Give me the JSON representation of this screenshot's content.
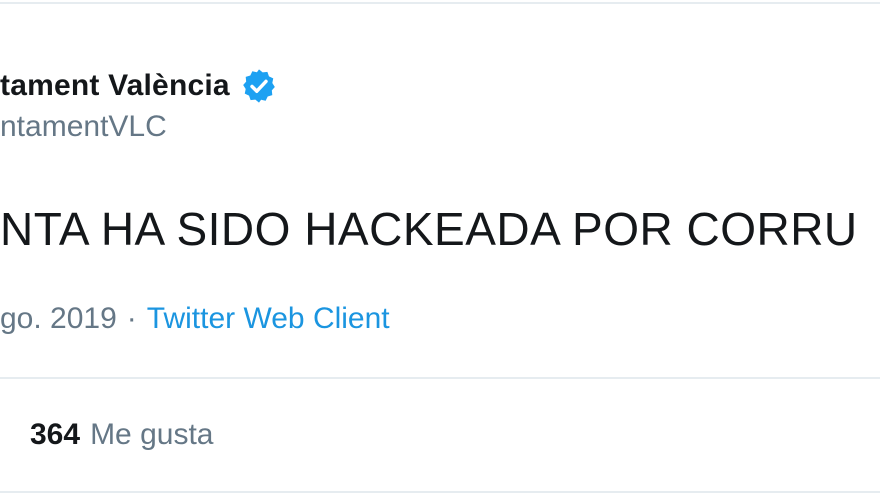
{
  "tweet": {
    "author_name": "tament València",
    "handle": "ntamentVLC",
    "text": "NTA HA SIDO HACKEADA POR CORRU",
    "date": "go. 2019",
    "separator": "·",
    "source": "Twitter Web Client",
    "likes_count": "364",
    "likes_label": "Me gusta",
    "verified_icon": "verified-badge-icon"
  },
  "colors": {
    "verified": "#1da1f2",
    "link": "#1b95e0",
    "muted": "#657786",
    "text": "#14171a",
    "divider": "#e6ecf0"
  }
}
